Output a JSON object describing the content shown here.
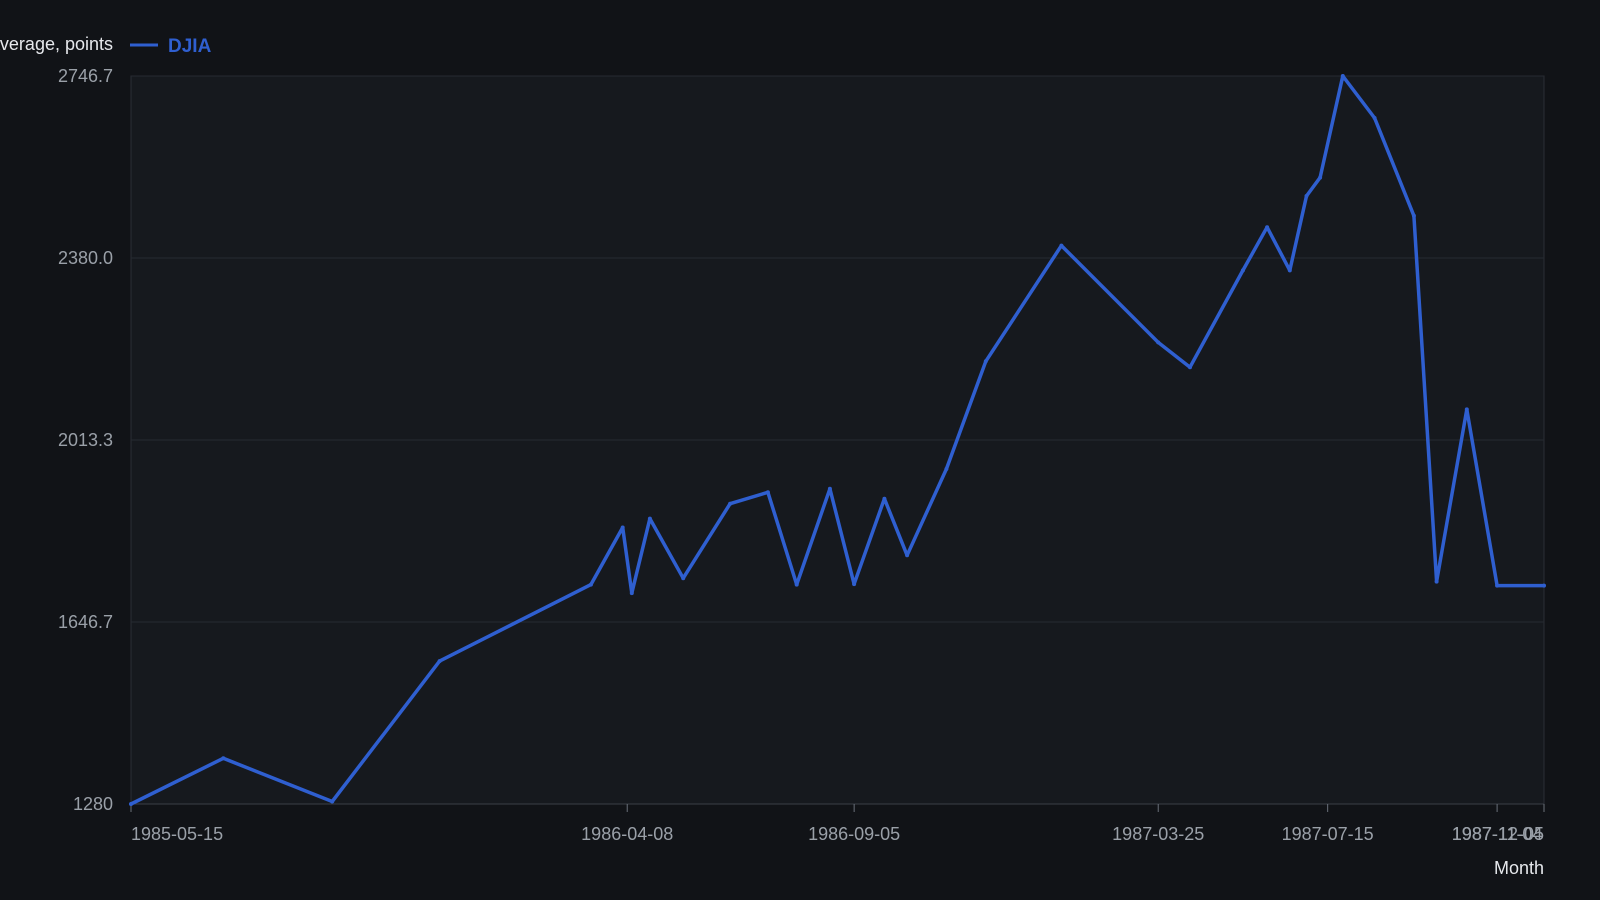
{
  "chart_data": {
    "type": "line",
    "ylabel": "Dow Jones Industrial Average, points",
    "xlabel": "Month",
    "legend_placement": "top-left",
    "grid": true,
    "ylim": [
      1280,
      2746.7
    ],
    "y_ticks": [
      "1280",
      "1646.7",
      "2013.3",
      "2380.0",
      "2746.7"
    ],
    "x_ticks": [
      "1985-05-15",
      "1986-04-08",
      "1986-09-05",
      "1987-03-25",
      "1987-07-15",
      "1987-11-04",
      "1987-12-05"
    ],
    "x_range": [
      "1985-05-15",
      "1987-12-05"
    ],
    "series": [
      {
        "name": "DJIA",
        "color": "#2f5fd0",
        "x": [
          "1985-05-15",
          "1985-07-15",
          "1985-09-25",
          "1985-12-05",
          "1986-03-15",
          "1986-04-05",
          "1986-04-11",
          "1986-04-23",
          "1986-05-15",
          "1986-06-15",
          "1986-07-10",
          "1986-07-29",
          "1986-08-20",
          "1986-09-05",
          "1986-09-25",
          "1986-10-10",
          "1986-11-05",
          "1986-12-01",
          "1987-01-20",
          "1987-03-25",
          "1987-04-15",
          "1987-05-20",
          "1987-06-05",
          "1987-06-20",
          "1987-07-01",
          "1987-07-10",
          "1987-07-25",
          "1987-08-15",
          "1987-09-10",
          "1987-09-25",
          "1987-10-15",
          "1987-11-04",
          "1987-12-05"
        ],
        "values": [
          1280,
          1372,
          1285,
          1568,
          1722,
          1837,
          1705,
          1855,
          1735,
          1885,
          1908,
          1722,
          1915,
          1723,
          1895,
          1781,
          1955,
          2172,
          2405,
          2210,
          2160,
          2355,
          2442,
          2355,
          2505,
          2542,
          2746.7,
          2662,
          2465,
          1728,
          2075,
          1720,
          1720
        ]
      }
    ]
  }
}
